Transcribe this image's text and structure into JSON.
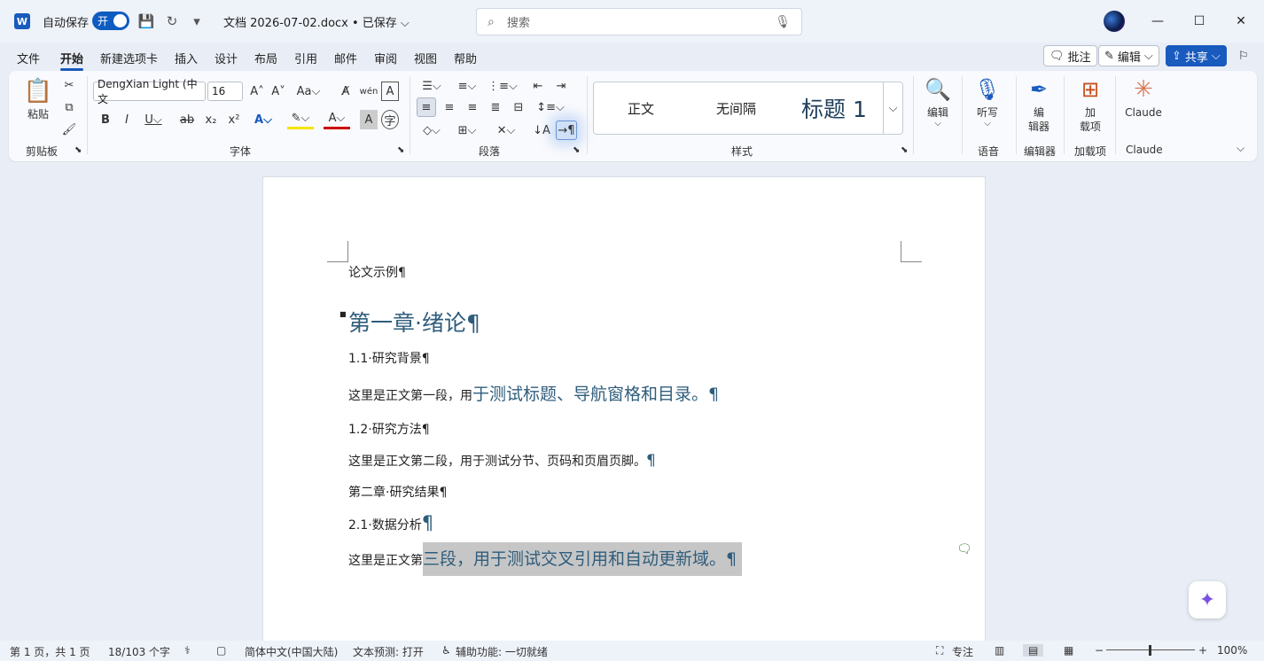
{
  "titlebar": {
    "app_icon": "W",
    "autosave_label": "自动保存",
    "toggle_label": "开",
    "doc_title": "文档 2026-07-02.docx • 已保存 ⌵",
    "search_placeholder": "搜索",
    "qa_icons": [
      "save-icon",
      "redo-icon",
      "customize-icon"
    ]
  },
  "tabs": [
    "文件",
    "开始",
    "新建选项卡",
    "插入",
    "设计",
    "布局",
    "引用",
    "邮件",
    "审阅",
    "视图",
    "帮助"
  ],
  "active_tab": "开始",
  "right_buttons": {
    "comments": "批注",
    "editing": "编辑",
    "share": "共享"
  },
  "ribbon": {
    "groups": [
      "剪贴板",
      "字体",
      "段落",
      "样式",
      "语音",
      "编辑器",
      "加载项",
      "Claude"
    ],
    "paste_label": "粘贴",
    "font_name": "DengXian Light (中文",
    "font_size": "16",
    "styles": [
      "正文",
      "无间隔",
      "标题 1"
    ],
    "editing_label": "编辑",
    "dictate_label": "听写",
    "editor_label_1": "编",
    "editor_label_2": "辑器",
    "addins_label_1": "加",
    "addins_label_2": "载项",
    "claude_label": "Claude"
  },
  "document": {
    "line1": "论文示例¶",
    "heading1_text": "第一章·绪论",
    "heading1_pm": "¶",
    "h11": "1.1·研究背景¶",
    "para1_a": "这里是正文第一段，用",
    "para1_b": "于测试标题、导航窗格和目录。",
    "para1_pm": "¶",
    "h12": "1.2·研究方法¶",
    "para2": "这里是正文第二段，用于测试分节、页码和页眉页脚。",
    "para2_pm": "¶",
    "chapter2": "第二章·研究结果¶",
    "h21": "2.1·数据分析",
    "h21_pm": "¶",
    "para3_a": "这里是正文第",
    "para3_b": "三段，用于测试交叉引用和自动更新域。",
    "para3_pm": "¶"
  },
  "status": {
    "page": "第 1 页，共 1 页",
    "words": "18/103 个字",
    "language": "简体中文(中国大陆)",
    "prediction": "文本预测: 打开",
    "accessibility": "辅助功能: 一切就绪",
    "focus": "专注",
    "zoom": "100%"
  }
}
